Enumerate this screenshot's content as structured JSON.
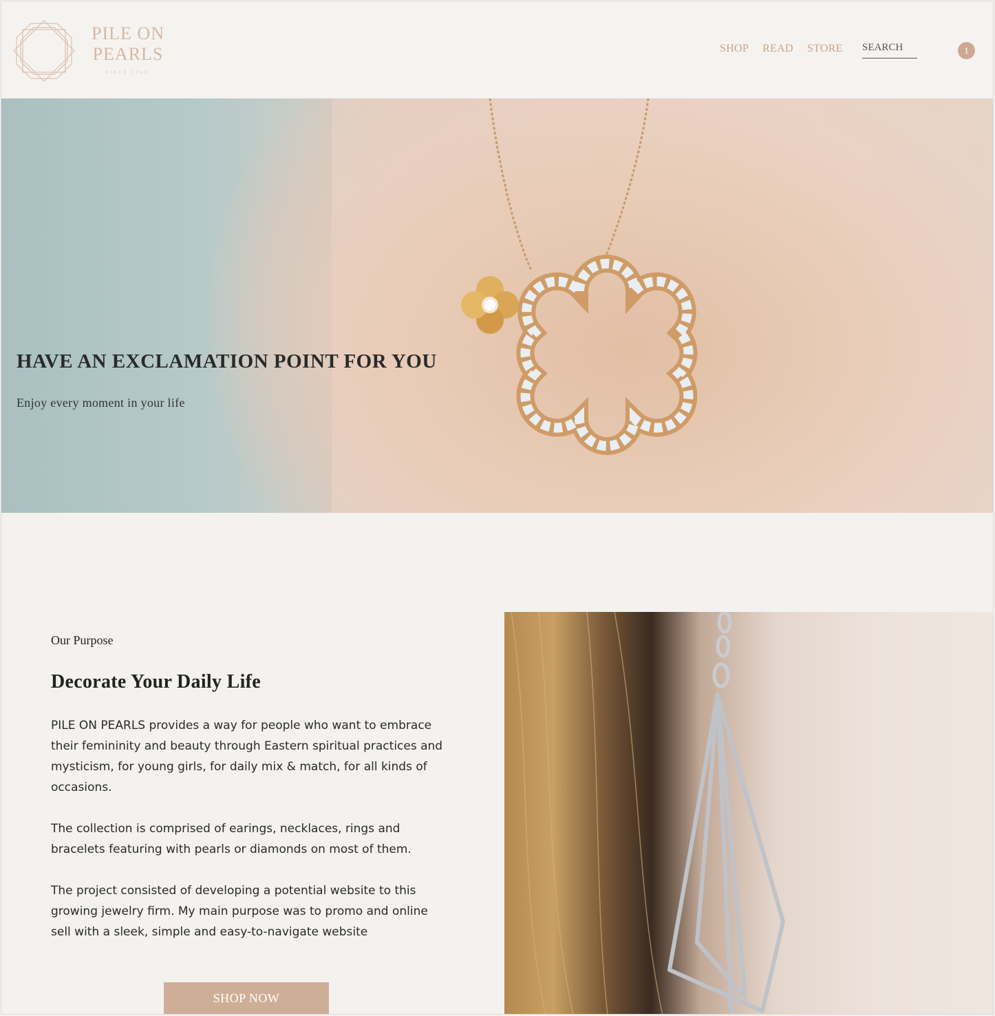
{
  "brand": {
    "name_line1": "PILE ON",
    "name_line2": "PEARLS",
    "tagline": "SINCE 2018",
    "colors": {
      "accent": "#c9a288",
      "badge": "#cda994",
      "button": "#cfae98",
      "background": "#f4f2ef"
    }
  },
  "nav": {
    "items": [
      {
        "label": "SHOP"
      },
      {
        "label": "READ"
      },
      {
        "label": "STORE"
      }
    ],
    "search_placeholder": "SEARCH",
    "cart_count": "1"
  },
  "hero": {
    "title": "HAVE AN EXCLAMATION POINT FOR YOU",
    "subtitle": "Enjoy every moment in your life"
  },
  "purpose": {
    "label": "Our Purpose",
    "heading": "Decorate Your Daily Life",
    "paragraphs": [
      "PILE ON PEARLS provides a way for people who want to embrace their femininity and beauty through Eastern spiritual practices and mysticism, for young girls, for daily mix & match, for all kinds of occasions.",
      "The collection is comprised of earings, necklaces, rings and bracelets featuring with pearls or diamonds on most of them.",
      "The project consisted of developing a potential website to this growing jewelry firm. My main purpose was to promo and online sell with a sleek, simple and easy-to-navigate website"
    ],
    "cta_label": "SHOP NOW"
  },
  "icons": {
    "logo": "octagon-diamond-logo-icon",
    "cart": "cart-count-badge"
  }
}
